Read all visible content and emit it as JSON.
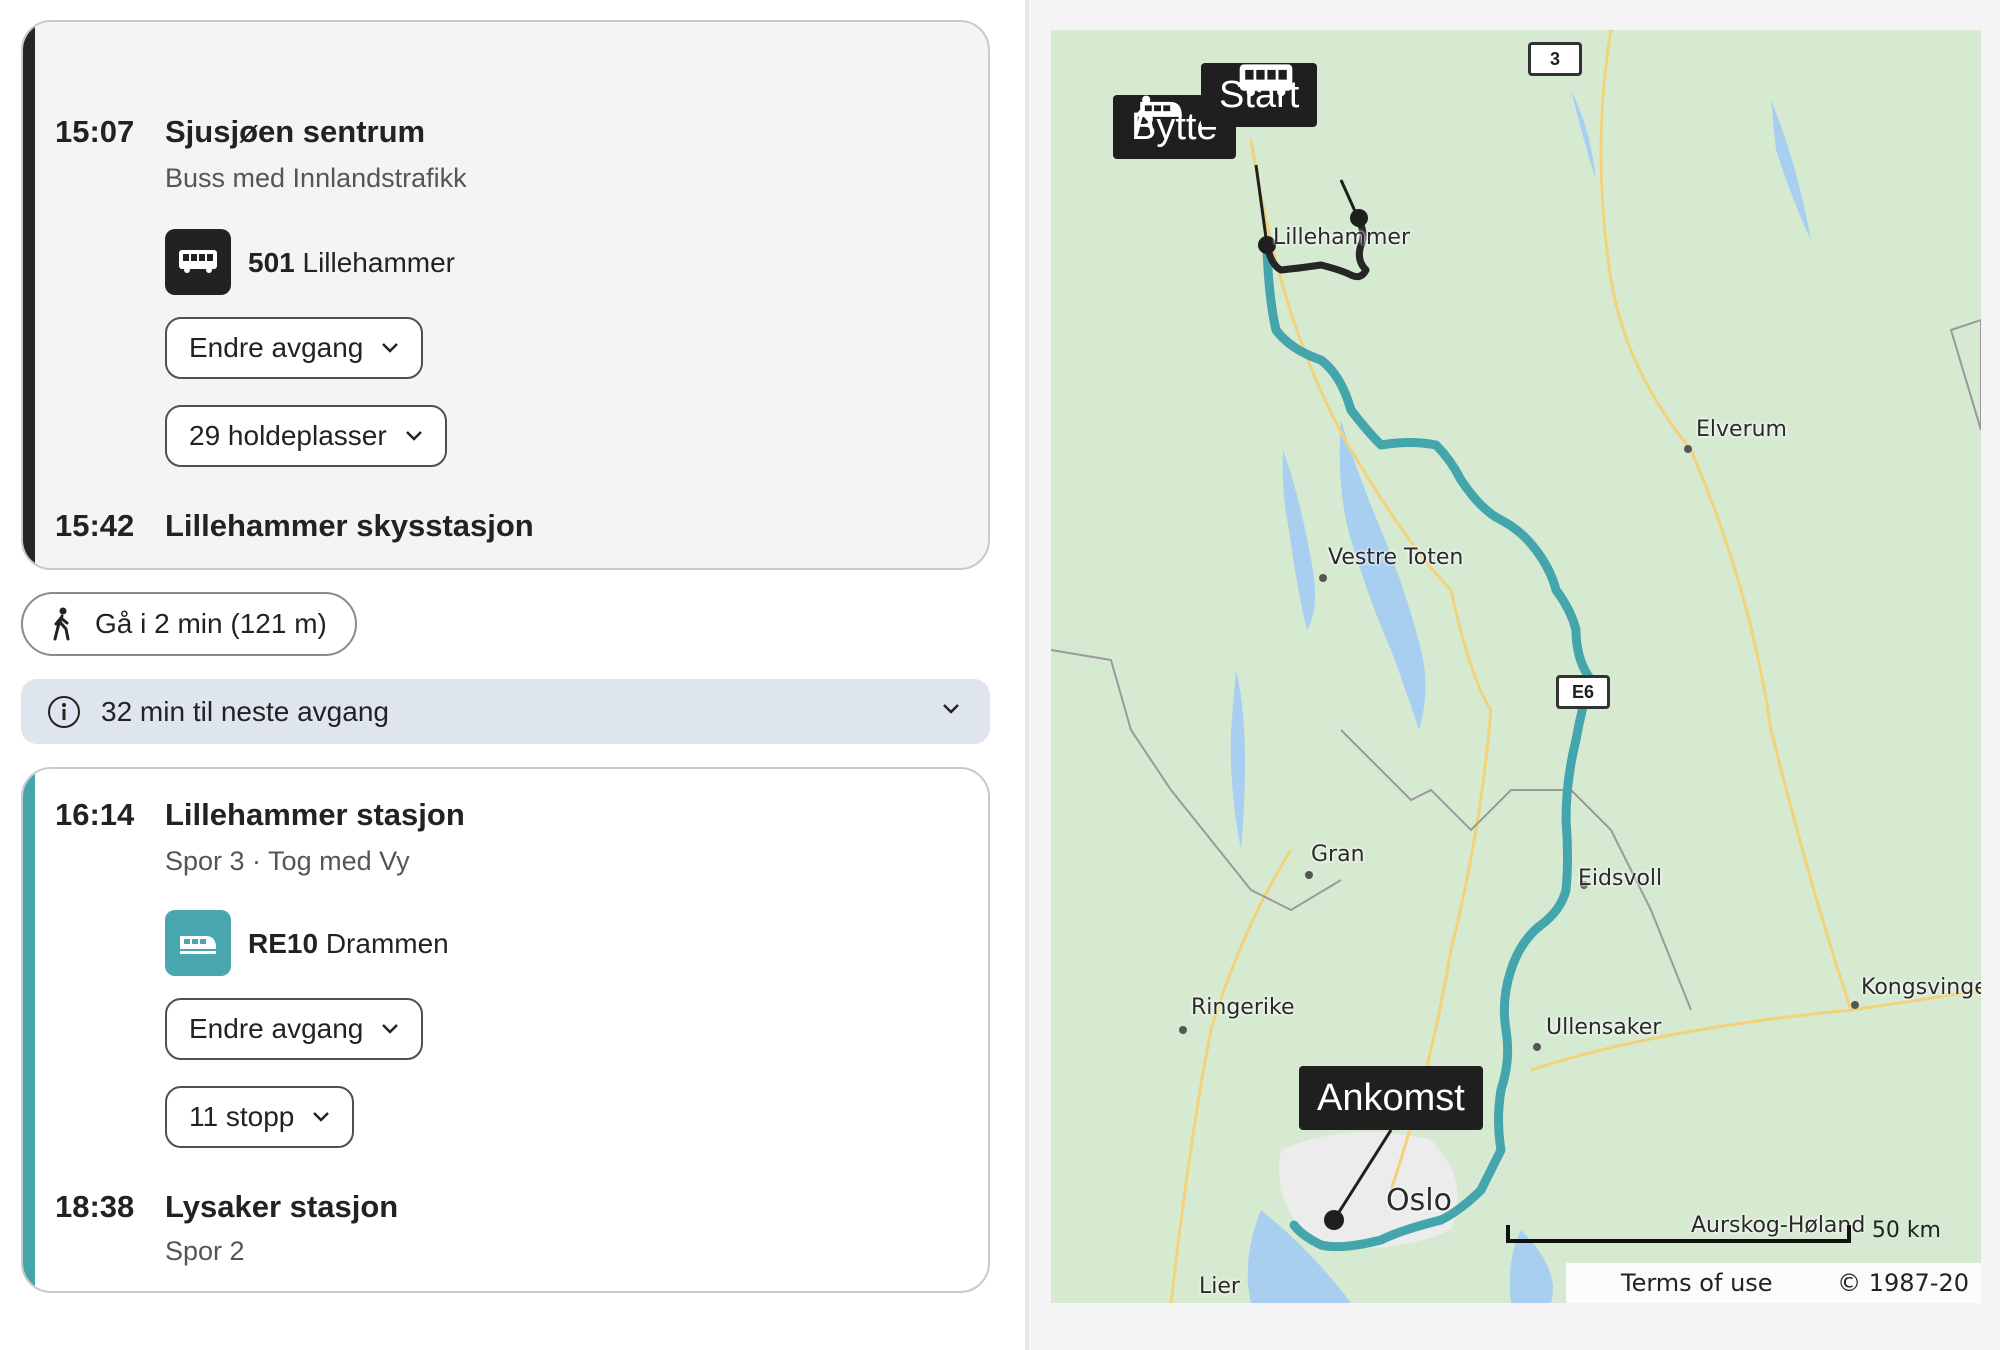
{
  "leg1": {
    "dep_time": "15:07",
    "dep_stop": "Sjusjøen sentrum",
    "mode_text": "Buss med Innlandstrafikk",
    "line_code": "501",
    "line_dest": "Lillehammer",
    "change_dep_label": "Endre avgang",
    "stops_label": "29 holdeplasser",
    "arr_time": "15:42",
    "arr_stop": "Lillehammer skysstasjon"
  },
  "walk": {
    "label": "Gå i 2 min (121 m)"
  },
  "wait": {
    "label": "32 min til neste avgang"
  },
  "leg2": {
    "dep_time": "16:14",
    "dep_stop": "Lillehammer stasjon",
    "mode_text": "Spor 3 · Tog med Vy",
    "line_code": "RE10",
    "line_dest": "Drammen",
    "change_dep_label": "Endre avgang",
    "stops_label": "11 stopp",
    "arr_time": "18:38",
    "arr_stop": "Lysaker stasjon",
    "arr_platform": "Spor 2"
  },
  "map": {
    "callouts": {
      "start": "Start",
      "change": "Bytte",
      "arrival": "Ankomst"
    },
    "places": {
      "lillehammer": "Lillehammer",
      "elverum": "Elverum",
      "vestre_toten": "Vestre Toten",
      "gran": "Gran",
      "eidsvoll": "Eidsvoll",
      "ringerike": "Ringerike",
      "kongsvinger": "Kongsvinge",
      "ullensaker": "Ullensaker",
      "oslo": "Oslo",
      "aurskog": "Aurskog-Høland",
      "lier": "Lier"
    },
    "road_shields": {
      "rv3": "3",
      "e6": "E6"
    },
    "scale_label": "50 km",
    "terms_label": "Terms of use",
    "copyright": "© 1987-20",
    "colors": {
      "bus_route": "#262626",
      "train_route": "#44a5ad",
      "water": "#a8cff0",
      "land": "#d6ead2",
      "road": "#f2d27a"
    }
  }
}
